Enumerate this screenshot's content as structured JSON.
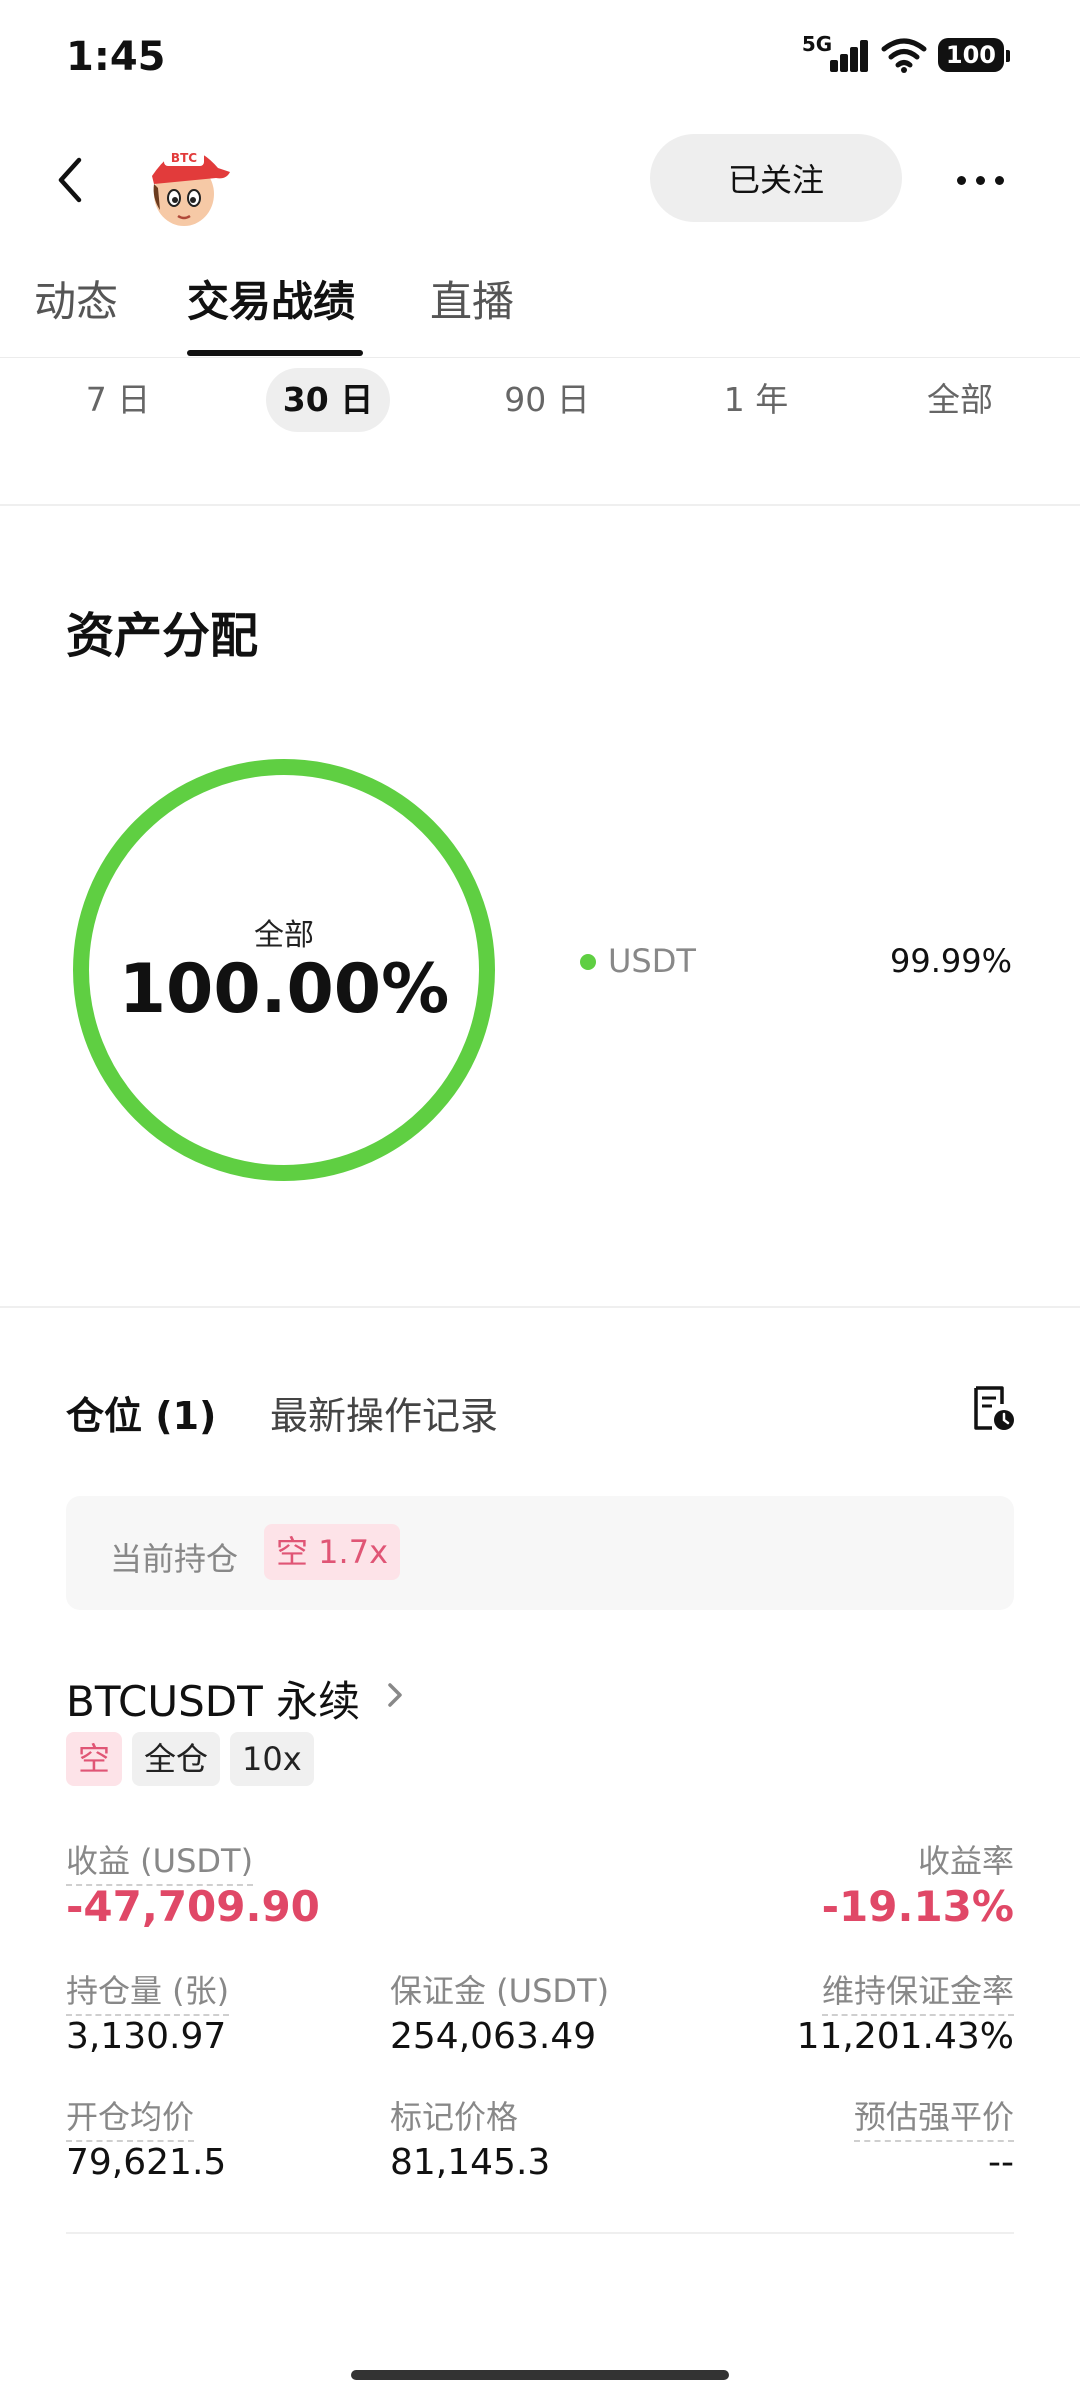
{
  "status_bar": {
    "time": "1:45",
    "network": "5G",
    "battery": "100"
  },
  "header": {
    "avatar_text": "BTC",
    "follow_label": "已关注"
  },
  "tabs": [
    {
      "label": "动态",
      "active": false
    },
    {
      "label": "交易战绩",
      "active": true
    },
    {
      "label": "直播",
      "active": false
    }
  ],
  "periods": [
    {
      "label": "7 日",
      "active": false
    },
    {
      "label": "30 日",
      "active": true
    },
    {
      "label": "90 日",
      "active": false
    },
    {
      "label": "1 年",
      "active": false
    },
    {
      "label": "全部",
      "active": false
    }
  ],
  "allocation": {
    "title": "资产分配",
    "center_label": "全部",
    "center_value": "100.00%",
    "ring_color": "#5fcf42",
    "legend": [
      {
        "name": "USDT",
        "percent": "99.99%",
        "color": "#5fcf42"
      }
    ]
  },
  "positions": {
    "tab_positions": "仓位 (1)",
    "tab_history": "最新操作记录",
    "holding_label": "当前持仓",
    "holding_badge": "空 1.7x",
    "symbol": "BTCUSDT 永续",
    "tags": [
      "空",
      "全仓",
      "10x"
    ],
    "pnl_label": "收益 (USDT)",
    "pnl_value": "-47,709.90",
    "roi_label": "收益率",
    "roi_value": "-19.13%",
    "size_label": "持仓量 (张)",
    "size_value": "3,130.97",
    "margin_label": "保证金 (USDT)",
    "margin_value": "254,063.49",
    "maint_label": "维持保证金率",
    "maint_value": "11,201.43%",
    "entry_label": "开仓均价",
    "entry_value": "79,621.5",
    "mark_label": "标记价格",
    "mark_value": "81,145.3",
    "liq_label": "预估强平价",
    "liq_value": "--"
  },
  "colors": {
    "short_red": "#e04867",
    "green": "#5fcf42"
  }
}
